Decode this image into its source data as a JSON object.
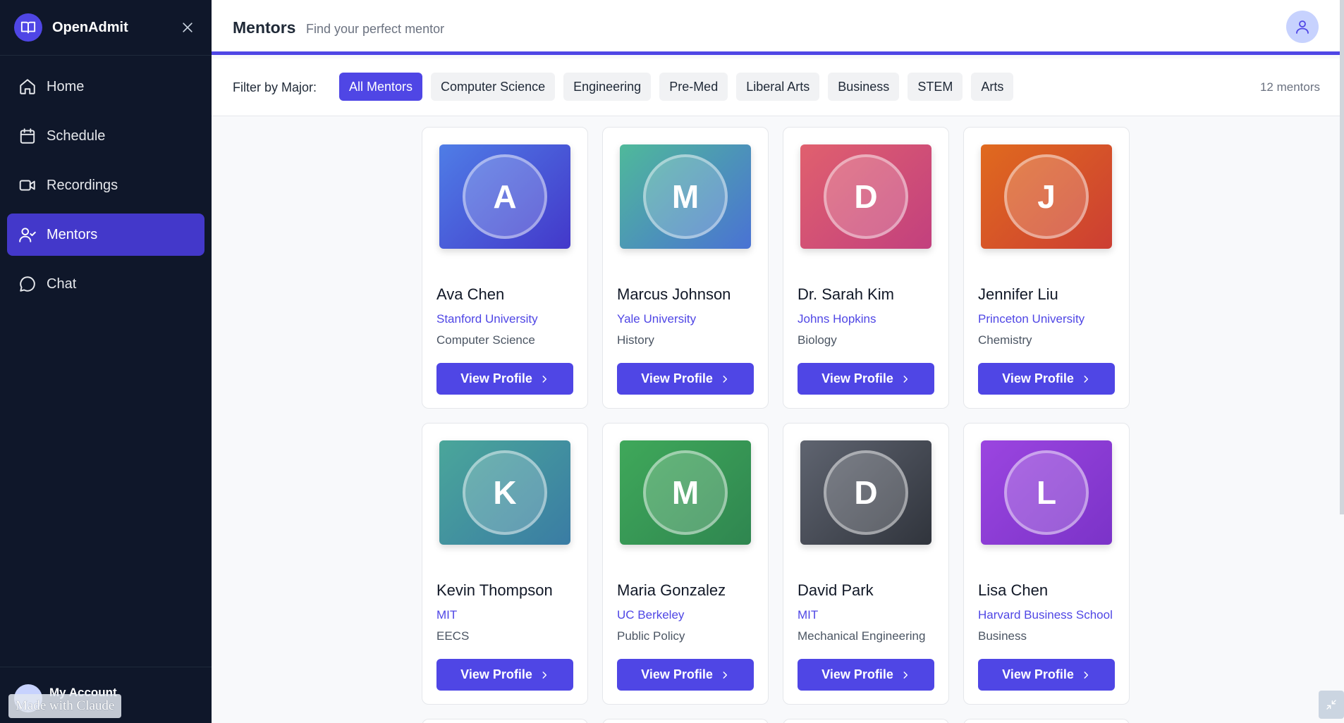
{
  "app": {
    "name": "OpenAdmit"
  },
  "sidebar": {
    "items": [
      {
        "label": "Home",
        "icon": "home-icon",
        "active": false
      },
      {
        "label": "Schedule",
        "icon": "calendar-icon",
        "active": false
      },
      {
        "label": "Recordings",
        "icon": "video-icon",
        "active": false
      },
      {
        "label": "Mentors",
        "icon": "user-check-icon",
        "active": true
      },
      {
        "label": "Chat",
        "icon": "chat-bubble-icon",
        "active": false
      }
    ],
    "account_label": "My Account",
    "made_with": "Made with Claude"
  },
  "header": {
    "title": "Mentors",
    "subtitle": "Find your perfect mentor"
  },
  "filter": {
    "label": "Filter by Major:",
    "chips": [
      {
        "label": "All Mentors",
        "active": true
      },
      {
        "label": "Computer Science",
        "active": false
      },
      {
        "label": "Engineering",
        "active": false
      },
      {
        "label": "Pre-Med",
        "active": false
      },
      {
        "label": "Liberal Arts",
        "active": false
      },
      {
        "label": "Business",
        "active": false
      },
      {
        "label": "STEM",
        "active": false
      },
      {
        "label": "Arts",
        "active": false
      }
    ],
    "count_text": "12 mentors"
  },
  "colors": {
    "accent": "#4f46e5",
    "sidebar_bg": "#0f172a",
    "active_nav": "#4338ca"
  },
  "mentors": [
    {
      "initial": "A",
      "name": "Ava Chen",
      "school": "Stanford University",
      "major": "Computer Science",
      "grad_from": "#4f7de6",
      "grad_to": "#4338ca",
      "button": "View Profile"
    },
    {
      "initial": "M",
      "name": "Marcus Johnson",
      "school": "Yale University",
      "major": "History",
      "grad_from": "#4fb99a",
      "grad_to": "#4a72d4",
      "button": "View Profile"
    },
    {
      "initial": "D",
      "name": "Dr. Sarah Kim",
      "school": "Johns Hopkins",
      "major": "Biology",
      "grad_from": "#e0606e",
      "grad_to": "#c2407e",
      "button": "View Profile"
    },
    {
      "initial": "J",
      "name": "Jennifer Liu",
      "school": "Princeton University",
      "major": "Chemistry",
      "grad_from": "#e06a1e",
      "grad_to": "#cc3e33",
      "button": "View Profile"
    },
    {
      "initial": "K",
      "name": "Kevin Thompson",
      "school": "MIT",
      "major": "EECS",
      "grad_from": "#4aa69a",
      "grad_to": "#3a7ca4",
      "button": "View Profile"
    },
    {
      "initial": "M",
      "name": "Maria Gonzalez",
      "school": "UC Berkeley",
      "major": "Public Policy",
      "grad_from": "#3fa85a",
      "grad_to": "#2f8650",
      "button": "View Profile"
    },
    {
      "initial": "D",
      "name": "David Park",
      "school": "MIT",
      "major": "Mechanical Engineering",
      "grad_from": "#5f6470",
      "grad_to": "#30343c",
      "button": "View Profile"
    },
    {
      "initial": "L",
      "name": "Lisa Chen",
      "school": "Harvard Business School",
      "major": "Business",
      "grad_from": "#9b45e0",
      "grad_to": "#7b33c8",
      "button": "View Profile"
    }
  ]
}
